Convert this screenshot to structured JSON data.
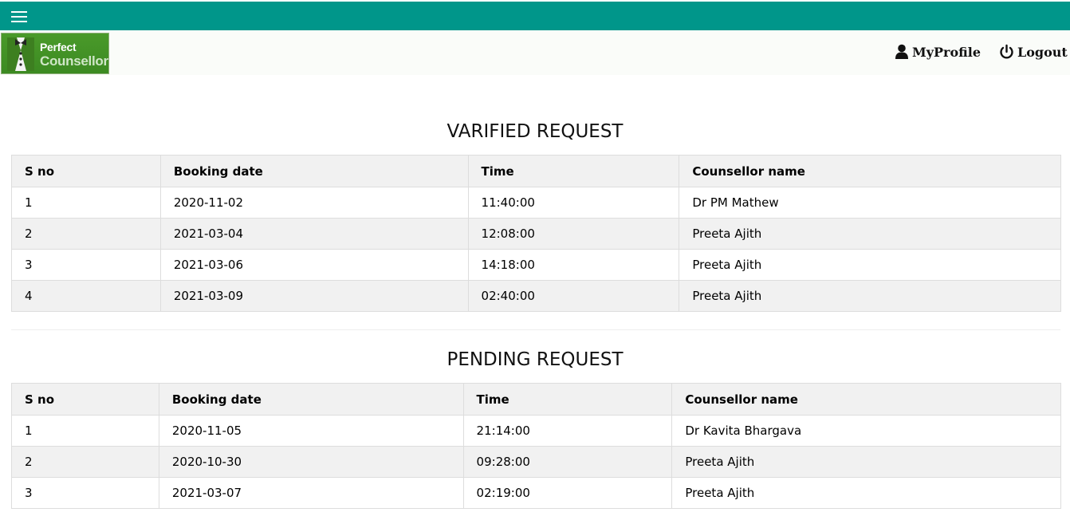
{
  "header": {
    "menu_icon": "hamburger-icon",
    "logo": {
      "line1": "Perfect",
      "line2": "Counsellor"
    },
    "nav": [
      {
        "label": "MyProfile",
        "icon": "user-icon"
      },
      {
        "label": "Logout",
        "icon": "power-icon"
      }
    ],
    "colors": {
      "topbar": "#00968a",
      "navbar": "#fafcf9"
    }
  },
  "verified": {
    "title": "VARIFIED REQUEST",
    "columns": [
      "S no",
      "Booking date",
      "Time",
      "Counsellor name"
    ],
    "rows": [
      [
        "1",
        "2020-11-02",
        "11:40:00",
        "Dr PM Mathew"
      ],
      [
        "2",
        "2021-03-04",
        "12:08:00",
        "Preeta Ajith"
      ],
      [
        "3",
        "2021-03-06",
        "14:18:00",
        "Preeta Ajith"
      ],
      [
        "4",
        "2021-03-09",
        "02:40:00",
        "Preeta Ajith"
      ]
    ]
  },
  "pending": {
    "title": "PENDING REQUEST",
    "columns": [
      "S no",
      "Booking date",
      "Time",
      "Counsellor name"
    ],
    "rows": [
      [
        "1",
        "2020-11-05",
        "21:14:00",
        "Dr Kavita Bhargava"
      ],
      [
        "2",
        "2020-10-30",
        "09:28:00",
        "Preeta Ajith"
      ],
      [
        "3",
        "2021-03-07",
        "02:19:00",
        "Preeta Ajith"
      ]
    ]
  }
}
